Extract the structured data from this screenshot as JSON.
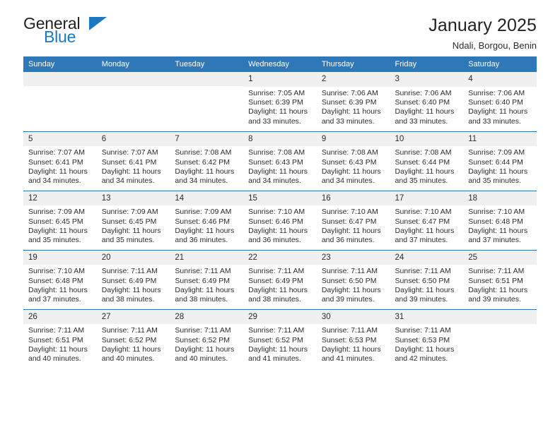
{
  "logo": {
    "word_top": "General",
    "word_bottom": "Blue",
    "accent_color": "#1c78c0"
  },
  "header": {
    "title": "January 2025",
    "subtitle": "Ndali, Borgou, Benin"
  },
  "theme": {
    "header_bg": "#2e77b8",
    "daynum_bg": "#f0f0f0",
    "text": "#2b2b2b"
  },
  "weekday_headers": [
    "Sunday",
    "Monday",
    "Tuesday",
    "Wednesday",
    "Thursday",
    "Friday",
    "Saturday"
  ],
  "labels": {
    "sunrise_prefix": "Sunrise:",
    "sunset_prefix": "Sunset:",
    "daylight_prefix": "Daylight:"
  },
  "weeks": [
    [
      {
        "day": "",
        "empty": true
      },
      {
        "day": "",
        "empty": true
      },
      {
        "day": "",
        "empty": true
      },
      {
        "day": "1",
        "sunrise": "Sunrise: 7:05 AM",
        "sunset": "Sunset: 6:39 PM",
        "daylight_1": "Daylight: 11 hours",
        "daylight_2": "and 33 minutes."
      },
      {
        "day": "2",
        "sunrise": "Sunrise: 7:06 AM",
        "sunset": "Sunset: 6:39 PM",
        "daylight_1": "Daylight: 11 hours",
        "daylight_2": "and 33 minutes."
      },
      {
        "day": "3",
        "sunrise": "Sunrise: 7:06 AM",
        "sunset": "Sunset: 6:40 PM",
        "daylight_1": "Daylight: 11 hours",
        "daylight_2": "and 33 minutes."
      },
      {
        "day": "4",
        "sunrise": "Sunrise: 7:06 AM",
        "sunset": "Sunset: 6:40 PM",
        "daylight_1": "Daylight: 11 hours",
        "daylight_2": "and 33 minutes."
      }
    ],
    [
      {
        "day": "5",
        "sunrise": "Sunrise: 7:07 AM",
        "sunset": "Sunset: 6:41 PM",
        "daylight_1": "Daylight: 11 hours",
        "daylight_2": "and 34 minutes."
      },
      {
        "day": "6",
        "sunrise": "Sunrise: 7:07 AM",
        "sunset": "Sunset: 6:41 PM",
        "daylight_1": "Daylight: 11 hours",
        "daylight_2": "and 34 minutes."
      },
      {
        "day": "7",
        "sunrise": "Sunrise: 7:08 AM",
        "sunset": "Sunset: 6:42 PM",
        "daylight_1": "Daylight: 11 hours",
        "daylight_2": "and 34 minutes."
      },
      {
        "day": "8",
        "sunrise": "Sunrise: 7:08 AM",
        "sunset": "Sunset: 6:43 PM",
        "daylight_1": "Daylight: 11 hours",
        "daylight_2": "and 34 minutes."
      },
      {
        "day": "9",
        "sunrise": "Sunrise: 7:08 AM",
        "sunset": "Sunset: 6:43 PM",
        "daylight_1": "Daylight: 11 hours",
        "daylight_2": "and 34 minutes."
      },
      {
        "day": "10",
        "sunrise": "Sunrise: 7:08 AM",
        "sunset": "Sunset: 6:44 PM",
        "daylight_1": "Daylight: 11 hours",
        "daylight_2": "and 35 minutes."
      },
      {
        "day": "11",
        "sunrise": "Sunrise: 7:09 AM",
        "sunset": "Sunset: 6:44 PM",
        "daylight_1": "Daylight: 11 hours",
        "daylight_2": "and 35 minutes."
      }
    ],
    [
      {
        "day": "12",
        "sunrise": "Sunrise: 7:09 AM",
        "sunset": "Sunset: 6:45 PM",
        "daylight_1": "Daylight: 11 hours",
        "daylight_2": "and 35 minutes."
      },
      {
        "day": "13",
        "sunrise": "Sunrise: 7:09 AM",
        "sunset": "Sunset: 6:45 PM",
        "daylight_1": "Daylight: 11 hours",
        "daylight_2": "and 35 minutes."
      },
      {
        "day": "14",
        "sunrise": "Sunrise: 7:09 AM",
        "sunset": "Sunset: 6:46 PM",
        "daylight_1": "Daylight: 11 hours",
        "daylight_2": "and 36 minutes."
      },
      {
        "day": "15",
        "sunrise": "Sunrise: 7:10 AM",
        "sunset": "Sunset: 6:46 PM",
        "daylight_1": "Daylight: 11 hours",
        "daylight_2": "and 36 minutes."
      },
      {
        "day": "16",
        "sunrise": "Sunrise: 7:10 AM",
        "sunset": "Sunset: 6:47 PM",
        "daylight_1": "Daylight: 11 hours",
        "daylight_2": "and 36 minutes."
      },
      {
        "day": "17",
        "sunrise": "Sunrise: 7:10 AM",
        "sunset": "Sunset: 6:47 PM",
        "daylight_1": "Daylight: 11 hours",
        "daylight_2": "and 37 minutes."
      },
      {
        "day": "18",
        "sunrise": "Sunrise: 7:10 AM",
        "sunset": "Sunset: 6:48 PM",
        "daylight_1": "Daylight: 11 hours",
        "daylight_2": "and 37 minutes."
      }
    ],
    [
      {
        "day": "19",
        "sunrise": "Sunrise: 7:10 AM",
        "sunset": "Sunset: 6:48 PM",
        "daylight_1": "Daylight: 11 hours",
        "daylight_2": "and 37 minutes."
      },
      {
        "day": "20",
        "sunrise": "Sunrise: 7:11 AM",
        "sunset": "Sunset: 6:49 PM",
        "daylight_1": "Daylight: 11 hours",
        "daylight_2": "and 38 minutes."
      },
      {
        "day": "21",
        "sunrise": "Sunrise: 7:11 AM",
        "sunset": "Sunset: 6:49 PM",
        "daylight_1": "Daylight: 11 hours",
        "daylight_2": "and 38 minutes."
      },
      {
        "day": "22",
        "sunrise": "Sunrise: 7:11 AM",
        "sunset": "Sunset: 6:49 PM",
        "daylight_1": "Daylight: 11 hours",
        "daylight_2": "and 38 minutes."
      },
      {
        "day": "23",
        "sunrise": "Sunrise: 7:11 AM",
        "sunset": "Sunset: 6:50 PM",
        "daylight_1": "Daylight: 11 hours",
        "daylight_2": "and 39 minutes."
      },
      {
        "day": "24",
        "sunrise": "Sunrise: 7:11 AM",
        "sunset": "Sunset: 6:50 PM",
        "daylight_1": "Daylight: 11 hours",
        "daylight_2": "and 39 minutes."
      },
      {
        "day": "25",
        "sunrise": "Sunrise: 7:11 AM",
        "sunset": "Sunset: 6:51 PM",
        "daylight_1": "Daylight: 11 hours",
        "daylight_2": "and 39 minutes."
      }
    ],
    [
      {
        "day": "26",
        "sunrise": "Sunrise: 7:11 AM",
        "sunset": "Sunset: 6:51 PM",
        "daylight_1": "Daylight: 11 hours",
        "daylight_2": "and 40 minutes."
      },
      {
        "day": "27",
        "sunrise": "Sunrise: 7:11 AM",
        "sunset": "Sunset: 6:52 PM",
        "daylight_1": "Daylight: 11 hours",
        "daylight_2": "and 40 minutes."
      },
      {
        "day": "28",
        "sunrise": "Sunrise: 7:11 AM",
        "sunset": "Sunset: 6:52 PM",
        "daylight_1": "Daylight: 11 hours",
        "daylight_2": "and 40 minutes."
      },
      {
        "day": "29",
        "sunrise": "Sunrise: 7:11 AM",
        "sunset": "Sunset: 6:52 PM",
        "daylight_1": "Daylight: 11 hours",
        "daylight_2": "and 41 minutes."
      },
      {
        "day": "30",
        "sunrise": "Sunrise: 7:11 AM",
        "sunset": "Sunset: 6:53 PM",
        "daylight_1": "Daylight: 11 hours",
        "daylight_2": "and 41 minutes."
      },
      {
        "day": "31",
        "sunrise": "Sunrise: 7:11 AM",
        "sunset": "Sunset: 6:53 PM",
        "daylight_1": "Daylight: 11 hours",
        "daylight_2": "and 42 minutes."
      },
      {
        "day": "",
        "empty": true
      }
    ]
  ]
}
